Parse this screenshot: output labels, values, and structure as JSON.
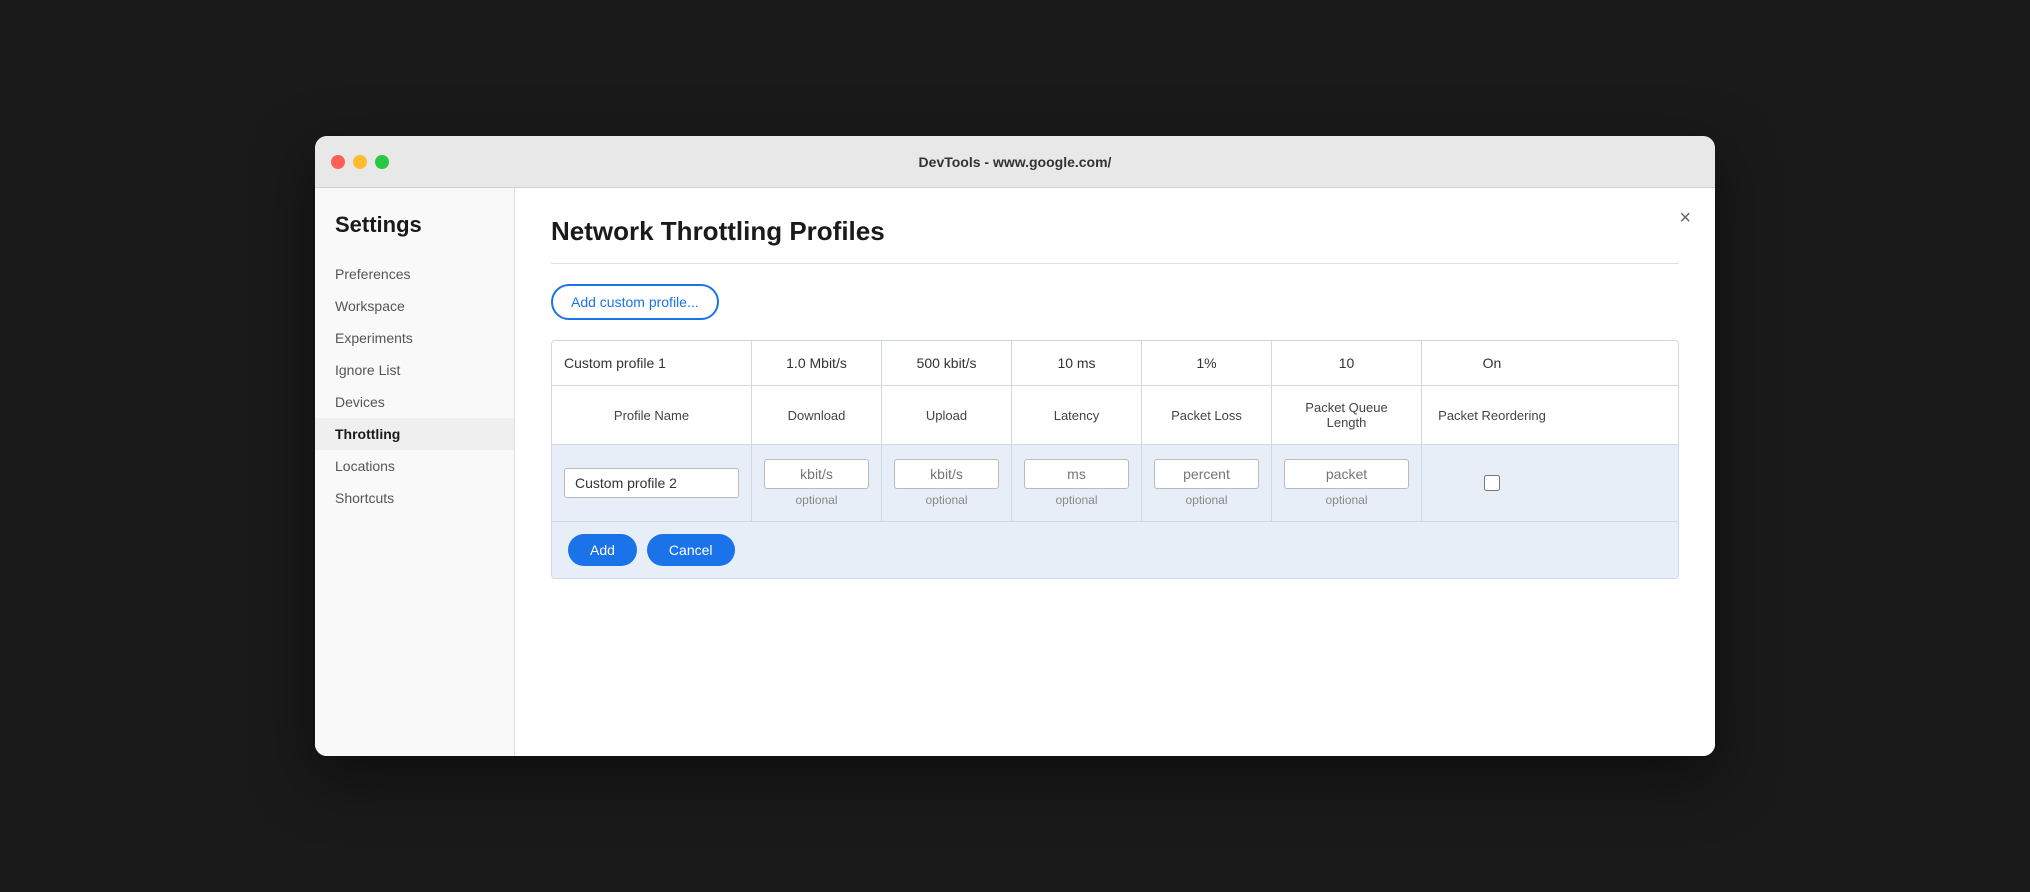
{
  "titlebar": {
    "title": "DevTools - www.google.com/"
  },
  "sidebar": {
    "heading": "Settings",
    "items": [
      {
        "label": "Preferences",
        "active": false
      },
      {
        "label": "Workspace",
        "active": false
      },
      {
        "label": "Experiments",
        "active": false
      },
      {
        "label": "Ignore List",
        "active": false
      },
      {
        "label": "Devices",
        "active": false
      },
      {
        "label": "Throttling",
        "active": true
      },
      {
        "label": "Locations",
        "active": false
      },
      {
        "label": "Shortcuts",
        "active": false
      }
    ]
  },
  "content": {
    "page_title": "Network Throttling Profiles",
    "add_button_label": "Add custom profile...",
    "close_label": "×",
    "table": {
      "existing_profile": {
        "name": "Custom profile 1",
        "download": "1.0 Mbit/s",
        "upload": "500 kbit/s",
        "latency": "10 ms",
        "packet_loss": "1%",
        "packet_queue": "10",
        "packet_reordering": "On"
      },
      "headers": {
        "name": "Profile Name",
        "download": "Download",
        "upload": "Upload",
        "latency": "Latency",
        "packet_loss": "Packet Loss",
        "packet_queue": "Packet Queue Length",
        "packet_reordering": "Packet Reordering"
      },
      "new_profile": {
        "name_value": "Custom profile 2",
        "name_placeholder": "",
        "download_placeholder": "kbit/s",
        "upload_placeholder": "kbit/s",
        "latency_placeholder": "ms",
        "packet_loss_placeholder": "percent",
        "packet_queue_placeholder": "packet",
        "optional_label": "optional"
      }
    },
    "add_label": "Add",
    "cancel_label": "Cancel"
  }
}
